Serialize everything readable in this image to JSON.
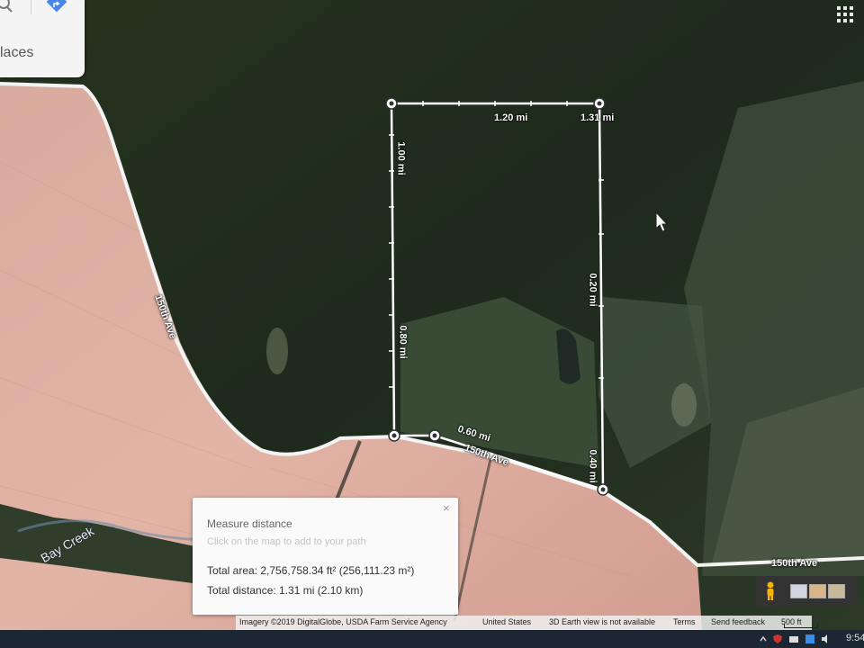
{
  "search_panel": {
    "places_label": "laces",
    "search_icon": "search-icon",
    "directions_icon": "directions-icon"
  },
  "apps_icon": "apps-grid-icon",
  "measure_path": {
    "distance_labels": [
      "1.20 mi",
      "1.31 mi",
      "1.00 mi",
      "0.80 mi",
      "0.60 mi",
      "0.40 mi",
      "0.20 mi"
    ],
    "line_color": "#ffffff"
  },
  "map_labels": {
    "road_west": "150th Ave",
    "road_south": "150th Ave",
    "road_east": "150th Ave",
    "creek": "Bay Creek"
  },
  "measure_card": {
    "title": "Measure distance",
    "hint": "Click on the map to add to your path",
    "total_area": "Total area: 2,756,758.34 ft² (256,111.23 m²)",
    "total_distance": "Total distance: 1.31 mi (2.10 km)",
    "close_label": "×"
  },
  "attribution": {
    "imagery": "Imagery ©2019 DigitalGlobe, USDA Farm Service Agency",
    "country": "United States",
    "earth": "3D Earth view is not available",
    "terms": "Terms",
    "feedback": "Send feedback",
    "scale": "500 ft"
  },
  "taskbar": {
    "clock": "9:54"
  },
  "colors": {
    "field": "#d9a79a",
    "forest": "#22301f",
    "road": "#f2f2f2"
  }
}
